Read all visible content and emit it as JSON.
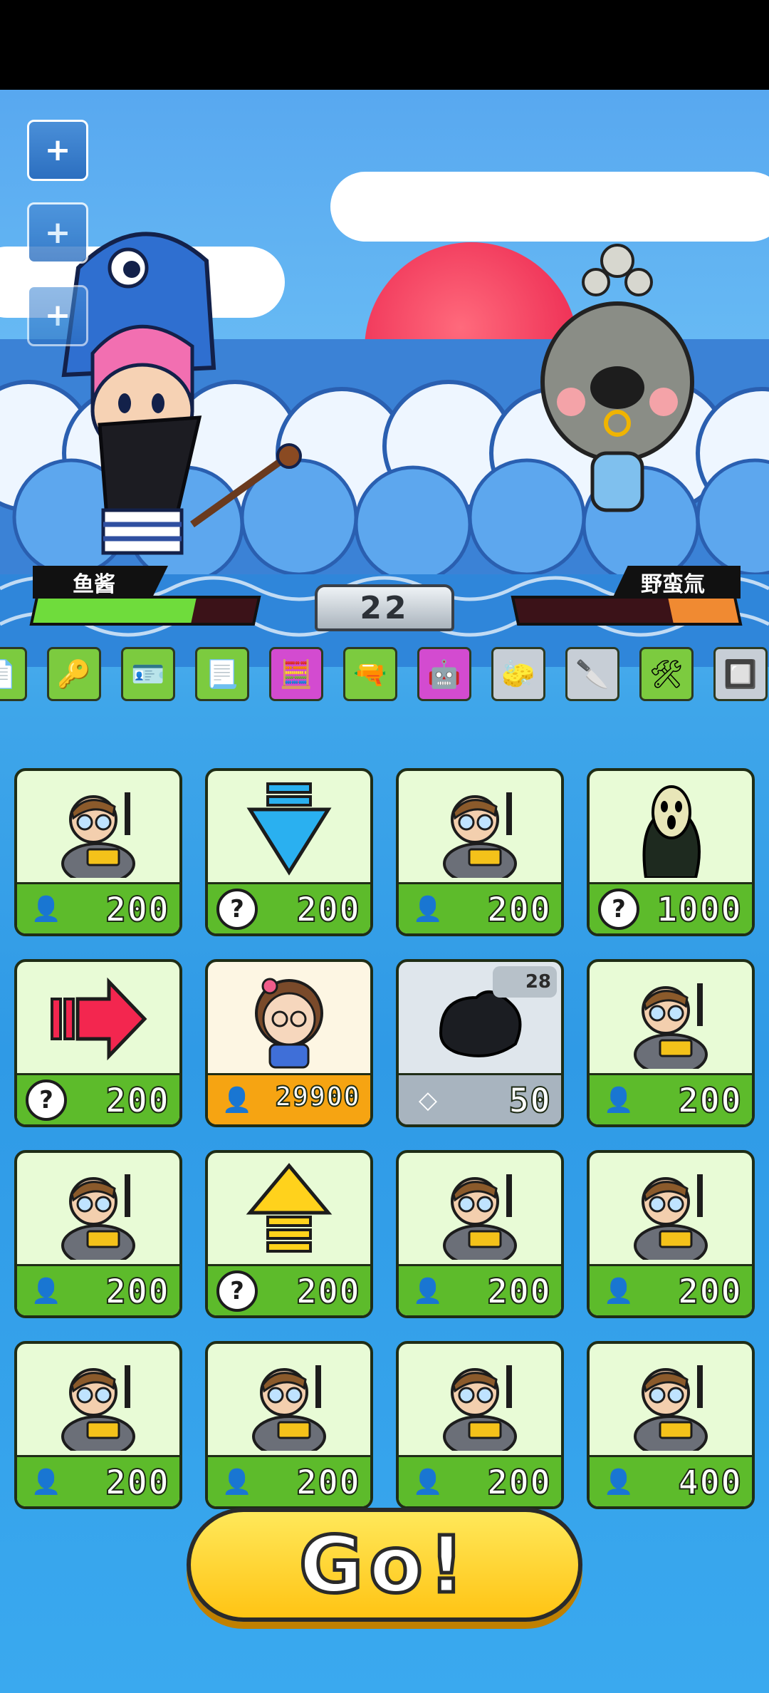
{
  "colors": {
    "sky": "#58a8f0",
    "player_hp": "#6fdc3c",
    "enemy_hp": "#f08a32",
    "card_green": "#5dbb2b",
    "card_orange": "#f6a412",
    "go_yellow": "#ffd12a"
  },
  "side_buttons": [
    {
      "icon": "plus-icon",
      "label": "+"
    },
    {
      "icon": "plus-icon",
      "label": "+"
    },
    {
      "icon": "plus-icon",
      "label": "+"
    }
  ],
  "battle": {
    "player_name": "鱼酱",
    "enemy_name": "野蛮氚",
    "counter": "22",
    "player_hp_fraction": 0.72,
    "enemy_hp_fraction": 0.3
  },
  "item_strip": [
    {
      "icon": "paper-icon",
      "bg": "#7ccb3f"
    },
    {
      "icon": "key-icon",
      "bg": "#7ccb3f"
    },
    {
      "icon": "id-card-icon",
      "bg": "#7ccb3f"
    },
    {
      "icon": "document-icon",
      "bg": "#7ccb3f"
    },
    {
      "icon": "calculator-icon",
      "bg": "#d34bd0"
    },
    {
      "icon": "gun-icon",
      "bg": "#7ccb3f"
    },
    {
      "icon": "robot-icon",
      "bg": "#d34bd0"
    },
    {
      "icon": "eraser-icon",
      "bg": "#c7ced6"
    },
    {
      "icon": "cleaver-icon",
      "bg": "#c7ced6"
    },
    {
      "icon": "turret-icon",
      "bg": "#7ccb3f"
    },
    {
      "icon": "circuit-icon",
      "bg": "#c7ced6"
    }
  ],
  "cards": [
    {
      "art": "businessman",
      "icon": "person-icon",
      "price": "200",
      "style": "green"
    },
    {
      "art": "arrow-down",
      "icon": "question-icon",
      "price": "200",
      "style": "green"
    },
    {
      "art": "businessman",
      "icon": "person-icon",
      "price": "200",
      "style": "green"
    },
    {
      "art": "scream",
      "icon": "question-icon",
      "price": "1000",
      "style": "green",
      "gold": true
    },
    {
      "art": "arrow-right",
      "icon": "question-icon",
      "price": "200",
      "style": "green"
    },
    {
      "art": "girl",
      "icon": "person-icon",
      "price": "29900",
      "style": "orange"
    },
    {
      "art": "coal",
      "icon": "diamond-icon",
      "price": "50",
      "style": "gray",
      "badge": "28"
    },
    {
      "art": "businessman",
      "icon": "person-icon",
      "price": "200",
      "style": "green"
    },
    {
      "art": "businessman",
      "icon": "person-icon",
      "price": "200",
      "style": "green"
    },
    {
      "art": "arrow-up",
      "icon": "question-icon",
      "price": "200",
      "style": "green"
    },
    {
      "art": "businessman",
      "icon": "person-icon",
      "price": "200",
      "style": "green"
    },
    {
      "art": "businessman",
      "icon": "person-icon",
      "price": "200",
      "style": "green"
    },
    {
      "art": "businessman",
      "icon": "person-icon",
      "price": "200",
      "style": "green"
    },
    {
      "art": "businessman",
      "icon": "person-icon",
      "price": "200",
      "style": "green"
    },
    {
      "art": "businessman",
      "icon": "person-icon",
      "price": "200",
      "style": "green"
    },
    {
      "art": "businessman",
      "icon": "person-icon",
      "price": "400",
      "style": "green"
    }
  ],
  "go_label": "Go!"
}
